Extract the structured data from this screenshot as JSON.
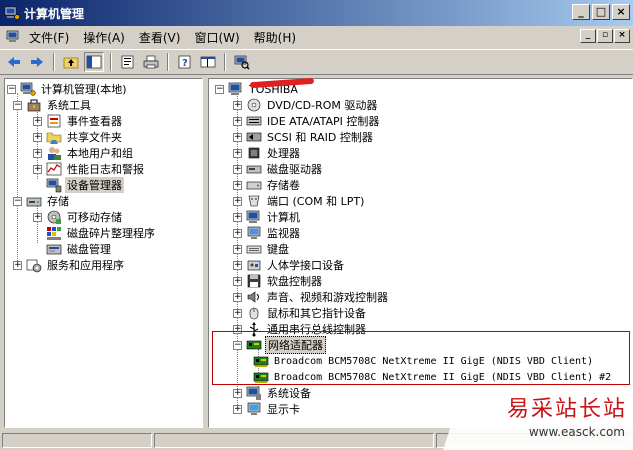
{
  "window": {
    "title": "计算机管理",
    "buttons": {
      "minimize": "_",
      "maximize": "□",
      "close": "×"
    }
  },
  "menu": [
    "文件(F)",
    "操作(A)",
    "查看(V)",
    "窗口(W)",
    "帮助(H)"
  ],
  "mdi": {
    "minimize": "_",
    "restore": "▫",
    "close": "×"
  },
  "toolbar_icons": [
    "back-icon",
    "forward-icon",
    "up-icon",
    "show-hide-tree-icon",
    "properties-icon",
    "print-icon",
    "help-icon",
    "export-icon",
    "scan-icon"
  ],
  "left_tree": {
    "root": "计算机管理(本地)",
    "system_tools": "系统工具",
    "event_viewer": "事件查看器",
    "shared_folders": "共享文件夹",
    "local_users": "本地用户和组",
    "perf_logs": "性能日志和警报",
    "device_manager": "设备管理器",
    "storage": "存储",
    "removable": "可移动存储",
    "defrag": "磁盘碎片整理程序",
    "disk_mgmt": "磁盘管理",
    "services_apps": "服务和应用程序"
  },
  "right_tree": {
    "root": "TOSHIBA",
    "items": [
      "DVD/CD-ROM 驱动器",
      "IDE ATA/ATAPI 控制器",
      "SCSI 和 RAID 控制器",
      "处理器",
      "磁盘驱动器",
      "存储卷",
      "端口 (COM 和 LPT)",
      "计算机",
      "监视器",
      "键盘",
      "人体学接口设备",
      "软盘控制器",
      "声音、视频和游戏控制器",
      "鼠标和其它指针设备",
      "通用串行总线控制器",
      "网络适配器",
      "系统设备",
      "显示卡"
    ],
    "network_children": [
      "Broadcom BCM5708C NetXtreme II GigE (NDIS VBD Client)",
      "Broadcom BCM5708C NetXtreme II GigE (NDIS VBD Client) #2"
    ]
  },
  "watermark": {
    "title": "易采站长站",
    "url": "www.easck.com"
  },
  "colors": {
    "highlight_box": "#c00000",
    "title_gradient_start": "#0a246a",
    "title_gradient_end": "#a6caf0"
  }
}
